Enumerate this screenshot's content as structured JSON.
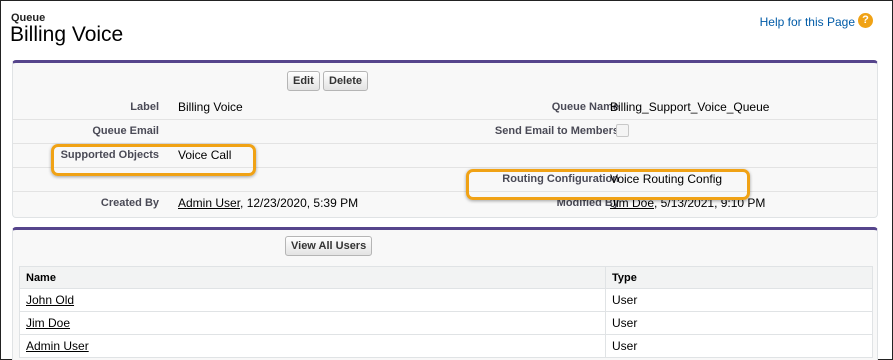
{
  "header": {
    "crumb": "Queue",
    "title": "Billing Voice",
    "help_link": "Help for this Page",
    "help_icon": "?"
  },
  "detail": {
    "buttons": {
      "edit": "Edit",
      "delete": "Delete"
    },
    "label": {
      "label": "Label",
      "value": "Billing Voice"
    },
    "queue_name": {
      "label": "Queue Name",
      "value": "Billing_Support_Voice_Queue"
    },
    "queue_email": {
      "label": "Queue Email",
      "value": ""
    },
    "send_email": {
      "label": "Send Email to Members",
      "checked": false
    },
    "supported_objects": {
      "label": "Supported Objects",
      "value": "Voice Call"
    },
    "routing_configuration": {
      "label": "Routing Configuration",
      "value": "Voice Routing Config"
    },
    "created_by": {
      "label": "Created By",
      "user": "Admin User",
      "date": ", 12/23/2020, 5:39 PM"
    },
    "modified_by": {
      "label": "Modified By",
      "user": "Jim Doe",
      "date": ", 5/13/2021, 9:10 PM"
    }
  },
  "users": {
    "view_all_button": "View All Users",
    "columns": [
      "Name",
      "Type"
    ],
    "rows": [
      {
        "name": "John Old",
        "type": "User"
      },
      {
        "name": "Jim Doe",
        "type": "User"
      },
      {
        "name": "Admin User",
        "type": "User"
      }
    ]
  },
  "colors": {
    "accent_border": "#56458c",
    "highlight": "#f0a215",
    "link": "#015ba7"
  }
}
